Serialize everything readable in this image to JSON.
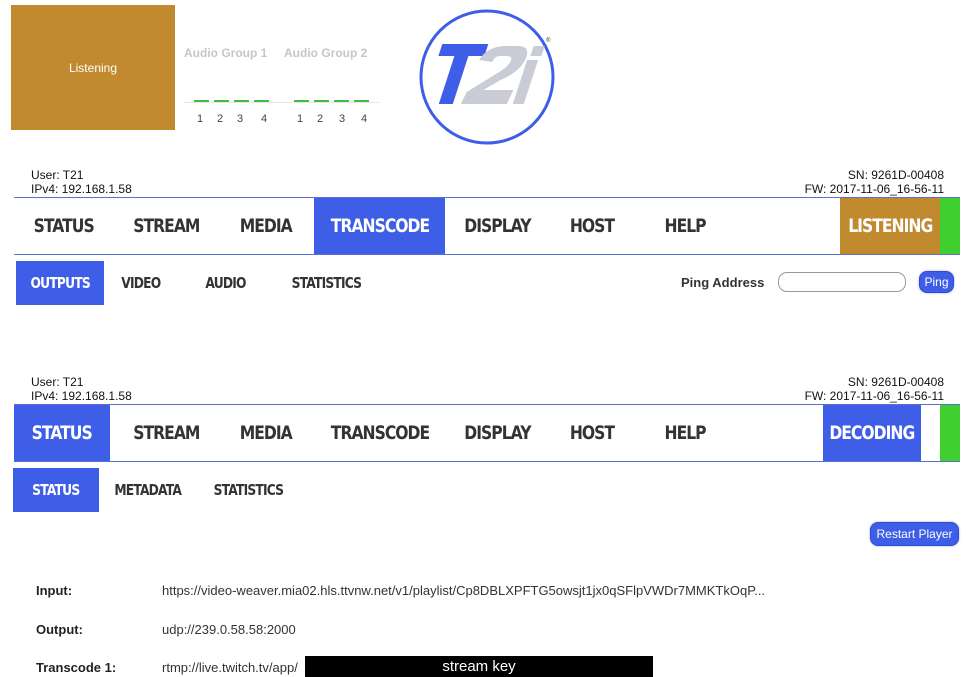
{
  "header": {
    "status_box_label": "Listening",
    "audio_groups": [
      {
        "label": "Audio Group 1",
        "channels": [
          "1",
          "2",
          "3",
          "4"
        ]
      },
      {
        "label": "Audio Group 2",
        "channels": [
          "1",
          "2",
          "3",
          "4"
        ]
      }
    ],
    "logo_text": "T2i"
  },
  "panel1": {
    "user": "User: T21",
    "ipv4": "IPv4: 192.168.1.58",
    "sn": "SN: 9261D-00408",
    "fw": "FW: 2017-11-06_16-56-11",
    "nav": [
      "STATUS",
      "STREAM",
      "MEDIA",
      "TRANSCODE",
      "DISPLAY",
      "HOST",
      "HELP"
    ],
    "active_nav": "TRANSCODE",
    "state_label": "LISTENING",
    "subnav": [
      "OUTPUTS",
      "VIDEO",
      "AUDIO",
      "STATISTICS"
    ],
    "active_subnav": "OUTPUTS",
    "ping_label": "Ping Address",
    "ping_placeholder": "",
    "ping_button": "Ping"
  },
  "panel2": {
    "user": "User: T21",
    "ipv4": "IPv4: 192.168.1.58",
    "sn": "SN: 9261D-00408",
    "fw": "FW: 2017-11-06_16-56-11",
    "nav": [
      "STATUS",
      "STREAM",
      "MEDIA",
      "TRANSCODE",
      "DISPLAY",
      "HOST",
      "HELP"
    ],
    "active_nav": "STATUS",
    "state_label": "DECODING",
    "subnav": [
      "STATUS",
      "METADATA",
      "STATISTICS"
    ],
    "active_subnav": "STATUS",
    "restart_button": "Restart Player",
    "fields": [
      {
        "label": "Input:",
        "value": "https://video-weaver.mia02.hls.ttvnw.net/v1/playlist/Cp8DBLXPFTG5owsjt1jx0qSFlpVWDr7MMKTkOqP..."
      },
      {
        "label": "Output:",
        "value": "udp://239.0.58.58:2000"
      },
      {
        "label": "Transcode 1:",
        "value": "rtmp://live.twitch.tv/app/"
      }
    ],
    "redaction_label": "stream key"
  },
  "colors": {
    "accent": "#3f5ee8",
    "listening": "#c18a2e",
    "indicator_green": "#3fcf2f",
    "meter_green": "#3fbf3f"
  }
}
